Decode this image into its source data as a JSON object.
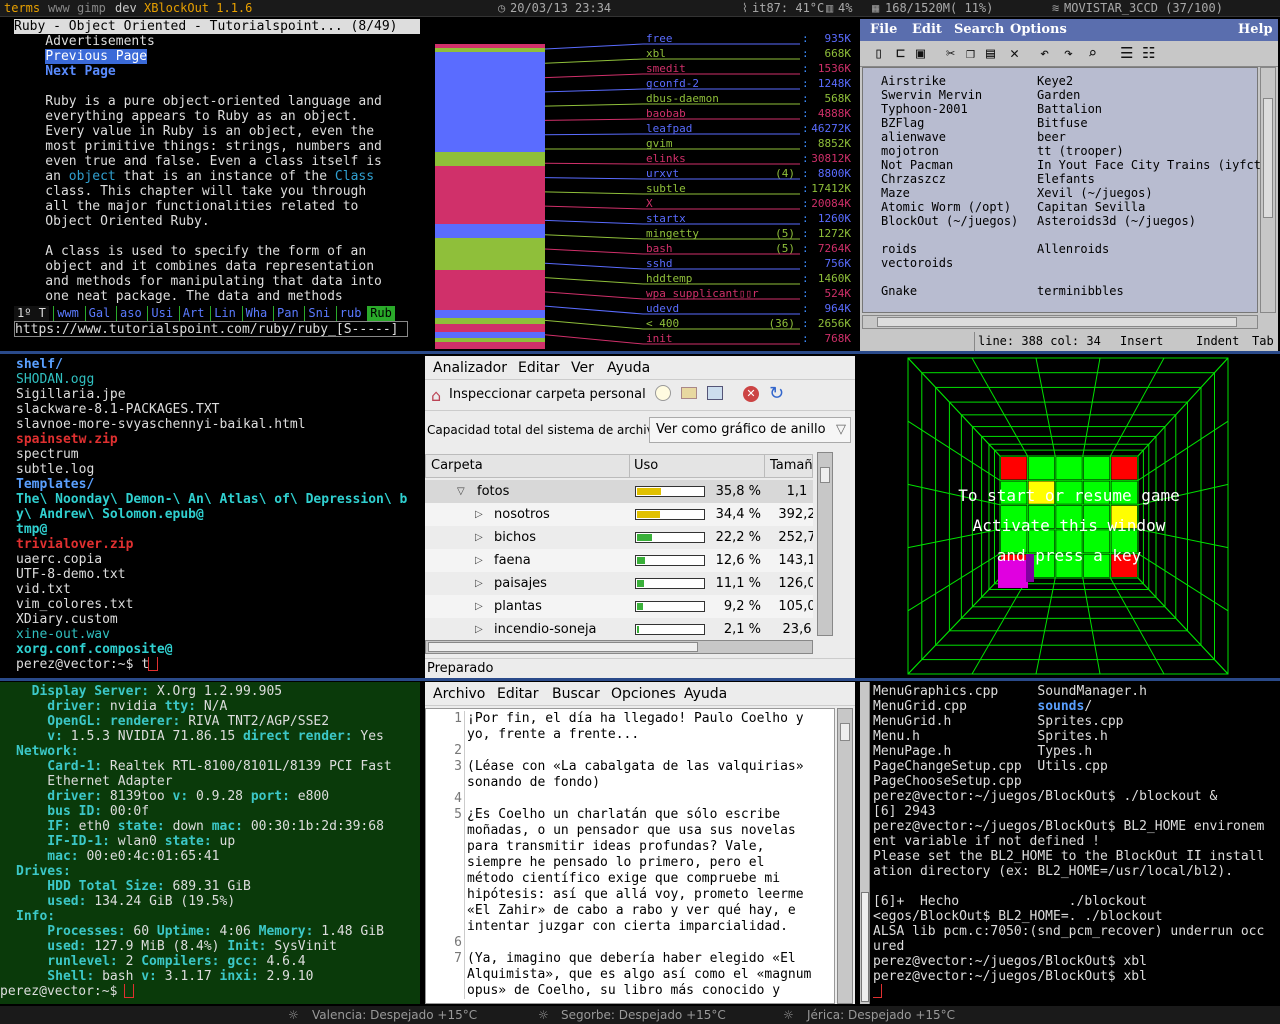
{
  "topbar": {
    "terms": "terms",
    "www": "www",
    "gimp": "gimp",
    "dev": "dev",
    "window_title": "XBlockOut 1.1.6",
    "datetime": "20/03/13 23:34",
    "temp": "it87: 41°C",
    "cpu": "4%",
    "mem": "168/1520M( 11%)",
    "wifi": "MOVISTAR_3CCD (37/100)"
  },
  "lynx": {
    "title": "Ruby - Object Oriented - Tutorialspoint... (8/49)",
    "lines": [
      {
        "t": "    Advertisements",
        "c": "#ddd"
      },
      {
        "t": "",
        "c": "#ddd",
        "special": "prev"
      },
      {
        "t": "    Next Page",
        "c": "#5a8cff",
        "bold": true
      },
      {
        "t": "",
        "c": "#ddd"
      },
      {
        "t": "    Ruby is a pure object-oriented language and",
        "c": "#ddd"
      },
      {
        "t": "    everything appears to Ruby as an object.",
        "c": "#ddd"
      },
      {
        "t": "    Every value in Ruby is an object, even the",
        "c": "#ddd"
      },
      {
        "t": "    most primitive things: strings, numbers and",
        "c": "#ddd"
      },
      {
        "t": "    even true and false. Even a class itself is",
        "c": "#ddd"
      },
      {
        "t": "",
        "c": "#ddd",
        "special": "object"
      },
      {
        "t": "    class. This chapter will take you through",
        "c": "#ddd"
      },
      {
        "t": "    all the major functionalities related to",
        "c": "#ddd"
      },
      {
        "t": "    Object Oriented Ruby.",
        "c": "#ddd"
      },
      {
        "t": "",
        "c": "#ddd"
      },
      {
        "t": "    A class is used to specify the form of an",
        "c": "#ddd"
      },
      {
        "t": "    object and it combines data representation",
        "c": "#ddd"
      },
      {
        "t": "    and methods for manipulating that data into",
        "c": "#ddd"
      },
      {
        "t": "    one neat package. The data and methods",
        "c": "#ddd"
      }
    ],
    "prev_label": "Previous Page",
    "obj_pre": "    an ",
    "obj_link": "object",
    "obj_mid": " that is an instance of the ",
    "obj_class": "Class",
    "tabs": [
      "1º T",
      "wwm",
      "Gal",
      "aso",
      "Usi",
      "Art",
      "Lin",
      "Wha",
      "Pan",
      "Sni",
      "rub",
      "Rub"
    ],
    "url": "https://www.tutorialspoint.com/ruby/ruby_[S-----]"
  },
  "mem": {
    "procs": [
      {
        "name": "free",
        "count": "",
        "size": "935K",
        "color": "#5a6cff"
      },
      {
        "name": "xbl",
        "count": "",
        "size": "668K",
        "color": "#8fbf3a"
      },
      {
        "name": "smedit",
        "count": "",
        "size": "1536K",
        "color": "#d0306a"
      },
      {
        "name": "gconfd-2",
        "count": "",
        "size": "1248K",
        "color": "#5a6cff"
      },
      {
        "name": "dbus-daemon",
        "count": "",
        "size": "568K",
        "color": "#8fbf3a"
      },
      {
        "name": "baobab",
        "count": "",
        "size": "4888K",
        "color": "#d0306a"
      },
      {
        "name": "leafpad",
        "count": "",
        "size": "46272K",
        "color": "#5a6cff"
      },
      {
        "name": "gvim",
        "count": "",
        "size": "8852K",
        "color": "#8fbf3a"
      },
      {
        "name": "elinks",
        "count": "",
        "size": "30812K",
        "color": "#d0306a"
      },
      {
        "name": "urxvt",
        "count": "(4)",
        "size": "8800K",
        "color": "#5a6cff"
      },
      {
        "name": "subtle",
        "count": "",
        "size": "17412K",
        "color": "#8fbf3a"
      },
      {
        "name": "X",
        "count": "",
        "size": "20084K",
        "color": "#d0306a"
      },
      {
        "name": "startx",
        "count": "",
        "size": "1260K",
        "color": "#5a6cff"
      },
      {
        "name": "mingetty",
        "count": "(5)",
        "size": "1272K",
        "color": "#8fbf3a"
      },
      {
        "name": "bash",
        "count": "(5)",
        "size": "7264K",
        "color": "#d0306a"
      },
      {
        "name": "sshd",
        "count": "",
        "size": "756K",
        "color": "#5a6cff"
      },
      {
        "name": "hddtemp",
        "count": "",
        "size": "1460K",
        "color": "#8fbf3a"
      },
      {
        "name": "wpa_supplicant▯▯r",
        "count": "",
        "size": "524K",
        "color": "#d0306a"
      },
      {
        "name": "udevd",
        "count": "",
        "size": "964K",
        "color": "#5a6cff"
      },
      {
        "name": "< 400",
        "count": "(36)",
        "size": "2656K",
        "color": "#8fbf3a"
      },
      {
        "name": "init",
        "count": "",
        "size": "768K",
        "color": "#d0306a"
      }
    ]
  },
  "nedit": {
    "menu": [
      "File",
      "Edit",
      "Search",
      "Options",
      "Help"
    ],
    "col1": [
      "Airstrike",
      "Swervin Mervin",
      "Typhoon-2001",
      "BZFlag",
      "alienwave",
      "mojotron",
      "Not Pacman",
      "Chrzaszcz",
      "Maze",
      "Atomic Worm (/opt)",
      "BlockOut (~/juegos)",
      "",
      "roids",
      "vectoroids",
      "",
      "Gnake"
    ],
    "col2": [
      "Keye2",
      "Garden",
      "Battalion",
      "Bitfuse",
      "beer",
      "tt (trooper)",
      "In Yout Face City Trains (iyfct",
      "Elefants",
      "Xevil (~/juegos)",
      "Capitan Sevilla",
      "Asteroids3d (~/juegos)",
      "",
      "Allenroids",
      "",
      "",
      "terminibbles"
    ],
    "status_line": "line: 388 col: 34",
    "status_mode": "Insert",
    "status_indent": "Indent",
    "status_tab": "Tab"
  },
  "ls": {
    "items": [
      {
        "t": "shelf/",
        "c": "#5aa0ff",
        "bold": true,
        "slash": true
      },
      {
        "t": "SHODAN.ogg",
        "c": "#30c0c0"
      },
      {
        "t": "Sigillaria.jpe",
        "c": "#ddd"
      },
      {
        "t": "slackware-8.1-PACKAGES.TXT",
        "c": "#ddd"
      },
      {
        "t": "slavnoe-more-svyaschennyi-baikal.html",
        "c": "#ddd"
      },
      {
        "t": "spainsetw.zip",
        "c": "#e03030",
        "bold": true
      },
      {
        "t": "spectrum",
        "c": "#ddd"
      },
      {
        "t": "subtle.log",
        "c": "#ddd"
      },
      {
        "t": "Templates/",
        "c": "#5aa0ff",
        "bold": true
      },
      {
        "t": "The\\ Noonday\\ Demon-\\ An\\ Atlas\\ of\\ Depression\\ b",
        "c": "#30d0d0",
        "bold": true
      },
      {
        "t": "y\\ Andrew\\ Solomon.epub@",
        "c": "#30d0d0",
        "bold": true
      },
      {
        "t": "tmp@",
        "c": "#30d0d0",
        "bold": true
      },
      {
        "t": "trivialover.zip",
        "c": "#e03030",
        "bold": true
      },
      {
        "t": "uaerc.copia",
        "c": "#ddd"
      },
      {
        "t": "UTF-8-demo.txt",
        "c": "#ddd"
      },
      {
        "t": "vid.txt",
        "c": "#ddd"
      },
      {
        "t": "vim_colores.txt",
        "c": "#ddd"
      },
      {
        "t": "XDiary.custom",
        "c": "#ddd"
      },
      {
        "t": "xine-out.wav",
        "c": "#30c0c0"
      },
      {
        "t": "xorg.conf.composite@",
        "c": "#30d0d0",
        "bold": true
      }
    ],
    "prompt": "perez@vector:~$ t"
  },
  "baobab": {
    "menu": [
      "Analizador",
      "Editar",
      "Ver",
      "Ayuda"
    ],
    "scan_button": "Inspeccionar carpeta personal",
    "capacity_label": "Capacidad total del sistema de archivos:",
    "view_select": "Ver como gráfico de anillo",
    "columns": [
      "Carpeta",
      "Uso",
      "Tamañ"
    ],
    "rows": [
      {
        "name": "fotos",
        "pct": "35,8 %",
        "size": "1,1",
        "fill": 0.358,
        "color": "#e0c000",
        "expanded": true,
        "level": 0
      },
      {
        "name": "nosotros",
        "pct": "34,4 %",
        "size": "392,2",
        "fill": 0.344,
        "color": "#e0c000",
        "level": 1
      },
      {
        "name": "bichos",
        "pct": "22,2 %",
        "size": "252,7",
        "fill": 0.222,
        "color": "#3ab03a",
        "level": 1
      },
      {
        "name": "faena",
        "pct": "12,6 %",
        "size": "143,1",
        "fill": 0.126,
        "color": "#3ab03a",
        "level": 1
      },
      {
        "name": "paisajes",
        "pct": "11,1 %",
        "size": "126,0",
        "fill": 0.111,
        "color": "#3ab03a",
        "level": 1
      },
      {
        "name": "plantas",
        "pct": "9,2 %",
        "size": "105,0",
        "fill": 0.092,
        "color": "#3ab03a",
        "level": 1
      },
      {
        "name": "incendio-soneja",
        "pct": "2,1 %",
        "size": "23,6",
        "fill": 0.021,
        "color": "#3ab03a",
        "level": 1
      }
    ],
    "status": "Preparado"
  },
  "game": {
    "line1": "To start or resume game",
    "line2": "Activate this window",
    "line3": "and press a key"
  },
  "inxi": {
    "lines": [
      [
        [
          "  Display Server: ",
          "#3cc8c8"
        ],
        [
          "X.Org 1.2.99.905",
          "#ddd"
        ]
      ],
      [
        [
          "    driver: ",
          "#3cc8c8"
        ],
        [
          "nvidia ",
          "#ddd"
        ],
        [
          "tty: ",
          "#3cc8c8"
        ],
        [
          "N/A",
          "#ddd"
        ]
      ],
      [
        [
          "    OpenGL: renderer: ",
          "#3cc8c8"
        ],
        [
          "RIVA TNT2/AGP/SSE2",
          "#ddd"
        ]
      ],
      [
        [
          "    v: ",
          "#3cc8c8"
        ],
        [
          "1.5.3 NVIDIA 71.86.15 ",
          "#ddd"
        ],
        [
          "direct render: ",
          "#3cc8c8"
        ],
        [
          "Yes",
          "#ddd"
        ]
      ],
      [
        [
          "Network:",
          "#3cc8c8"
        ]
      ],
      [
        [
          "    Card-1: ",
          "#3cc8c8"
        ],
        [
          "Realtek RTL-8100/8101L/8139 PCI Fast",
          "#ddd"
        ]
      ],
      [
        [
          "    Ethernet Adapter",
          "#ddd"
        ]
      ],
      [
        [
          "    driver: ",
          "#3cc8c8"
        ],
        [
          "8139too ",
          "#ddd"
        ],
        [
          "v: ",
          "#3cc8c8"
        ],
        [
          "0.9.28 ",
          "#ddd"
        ],
        [
          "port: ",
          "#3cc8c8"
        ],
        [
          "e800",
          "#ddd"
        ]
      ],
      [
        [
          "    bus ID: ",
          "#3cc8c8"
        ],
        [
          "00:0f",
          "#ddd"
        ]
      ],
      [
        [
          "    IF: ",
          "#3cc8c8"
        ],
        [
          "eth0 ",
          "#ddd"
        ],
        [
          "state: ",
          "#3cc8c8"
        ],
        [
          "down ",
          "#ddd"
        ],
        [
          "mac: ",
          "#3cc8c8"
        ],
        [
          "00:30:1b:2d:39:68",
          "#ddd"
        ]
      ],
      [
        [
          "    IF-ID-1: ",
          "#3cc8c8"
        ],
        [
          "wlan0 ",
          "#ddd"
        ],
        [
          "state: ",
          "#3cc8c8"
        ],
        [
          "up",
          "#ddd"
        ]
      ],
      [
        [
          "    mac: ",
          "#3cc8c8"
        ],
        [
          "00:e0:4c:01:65:41",
          "#ddd"
        ]
      ],
      [
        [
          "Drives:",
          "#3cc8c8"
        ]
      ],
      [
        [
          "    HDD Total Size: ",
          "#3cc8c8"
        ],
        [
          "689.31 GiB",
          "#ddd"
        ]
      ],
      [
        [
          "    used: ",
          "#3cc8c8"
        ],
        [
          "134.24 GiB (19.5%)",
          "#ddd"
        ]
      ],
      [
        [
          "Info:",
          "#3cc8c8"
        ]
      ],
      [
        [
          "    Processes: ",
          "#3cc8c8"
        ],
        [
          "60 ",
          "#ddd"
        ],
        [
          "Uptime: ",
          "#3cc8c8"
        ],
        [
          "4:06 ",
          "#ddd"
        ],
        [
          "Memory: ",
          "#3cc8c8"
        ],
        [
          "1.48 GiB",
          "#ddd"
        ]
      ],
      [
        [
          "    used: ",
          "#3cc8c8"
        ],
        [
          "127.9 MiB (8.4%) ",
          "#ddd"
        ],
        [
          "Init: ",
          "#3cc8c8"
        ],
        [
          "SysVinit",
          "#ddd"
        ]
      ],
      [
        [
          "    runlevel: ",
          "#3cc8c8"
        ],
        [
          "2 ",
          "#ddd"
        ],
        [
          "Compilers: ",
          "#3cc8c8"
        ],
        [
          "gcc: ",
          "#3cc8c8"
        ],
        [
          "4.6.4",
          "#ddd"
        ]
      ],
      [
        [
          "    Shell: ",
          "#3cc8c8"
        ],
        [
          "bash ",
          "#ddd"
        ],
        [
          "v: ",
          "#3cc8c8"
        ],
        [
          "3.1.17 ",
          "#ddd"
        ],
        [
          "inxi: ",
          "#3cc8c8"
        ],
        [
          "2.9.10",
          "#ddd"
        ]
      ]
    ],
    "prompt": "perez@vector:~$ "
  },
  "leafpad": {
    "menu": [
      "Archivo",
      "Editar",
      "Buscar",
      "Opciones",
      "Ayuda"
    ],
    "lines": [
      {
        "n": "1",
        "t": "¡Por fin, el día ha llegado! Paulo Coelho y"
      },
      {
        "n": "",
        "t": "yo, frente a frente..."
      },
      {
        "n": "2",
        "t": ""
      },
      {
        "n": "3",
        "t": "(Léase con «La cabalgata de las valquirias»"
      },
      {
        "n": "",
        "t": "sonando de fondo)"
      },
      {
        "n": "4",
        "t": ""
      },
      {
        "n": "5",
        "t": "¿Es Coelho un charlatán que sólo escribe"
      },
      {
        "n": "",
        "t": "moñadas, o un pensador que usa sus novelas"
      },
      {
        "n": "",
        "t": "para transmitir ideas profundas? Vale,"
      },
      {
        "n": "",
        "t": "siempre he pensado lo primero, pero el"
      },
      {
        "n": "",
        "t": "método científico exige que compruebe mi"
      },
      {
        "n": "",
        "t": "hipótesis: así que allá voy, prometo leerme"
      },
      {
        "n": "",
        "t": "«El Zahir» de cabo a rabo y ver qué hay, e"
      },
      {
        "n": "",
        "t": "intentar juzgar con cierta imparcialidad."
      },
      {
        "n": "6",
        "t": ""
      },
      {
        "n": "7",
        "t": "(Ya, imagino que debería haber elegido «El"
      },
      {
        "n": "",
        "t": "Alquimista», que es algo así como el «magnum"
      },
      {
        "n": "",
        "t": "opus» de Coelho, su libro más conocido y"
      }
    ]
  },
  "term": {
    "lines": [
      [
        [
          "MenuGraphics.cpp     ",
          "#ddd"
        ],
        [
          "SoundManager.h",
          "#ddd"
        ]
      ],
      [
        [
          "MenuGrid.cpp         ",
          "#ddd"
        ],
        [
          "sounds",
          "#5aa0ff"
        ],
        [
          "/",
          "#ddd"
        ]
      ],
      [
        [
          "MenuGrid.h           ",
          "#ddd"
        ],
        [
          "Sprites.cpp",
          "#ddd"
        ]
      ],
      [
        [
          "Menu.h               ",
          "#ddd"
        ],
        [
          "Sprites.h",
          "#ddd"
        ]
      ],
      [
        [
          "MenuPage.h           ",
          "#ddd"
        ],
        [
          "Types.h",
          "#ddd"
        ]
      ],
      [
        [
          "PageChangeSetup.cpp  ",
          "#ddd"
        ],
        [
          "Utils.cpp",
          "#ddd"
        ]
      ],
      [
        [
          "PageChooseSetup.cpp",
          "#ddd"
        ]
      ],
      [
        [
          "perez@vector:~/juegos/BlockOut$ ./blockout &",
          "#ddd"
        ]
      ],
      [
        [
          "[6] 2943",
          "#ddd"
        ]
      ],
      [
        [
          "perez@vector:~/juegos/BlockOut$ BL2_HOME environem",
          "#ddd"
        ]
      ],
      [
        [
          "ent variable if not defined !",
          "#ddd"
        ]
      ],
      [
        [
          "Please set the BL2_HOME to the BlockOut II install",
          "#ddd"
        ]
      ],
      [
        [
          "ation directory (ex: BL2_HOME=/usr/local/bl2).",
          "#ddd"
        ]
      ],
      [
        [
          "",
          "#ddd"
        ]
      ],
      [
        [
          "[6]+  Hecho              ./blockout",
          "#ddd"
        ]
      ],
      [
        [
          "<egos/BlockOut$ BL2_HOME=. ./blockout",
          "#ddd"
        ]
      ],
      [
        [
          "ALSA lib pcm.c:7050:(snd_pcm_recover) underrun occ",
          "#ddd"
        ]
      ],
      [
        [
          "ured",
          "#ddd"
        ]
      ],
      [
        [
          "perez@vector:~/juegos/BlockOut$ xbl",
          "#ddd"
        ]
      ],
      [
        [
          "perez@vector:~/juegos/BlockOut$ xbl",
          "#ddd"
        ]
      ]
    ]
  },
  "botbar": {
    "w1": "Valencia: Despejado +15°C",
    "w2": "Segorbe: Despejado +15°C",
    "w3": "Jérica: Despejado +15°C"
  },
  "colors": {
    "accent": "#2a4a8a",
    "terminal_green": "#0a3a0a",
    "nedit_bg": "#c7c7c7"
  }
}
